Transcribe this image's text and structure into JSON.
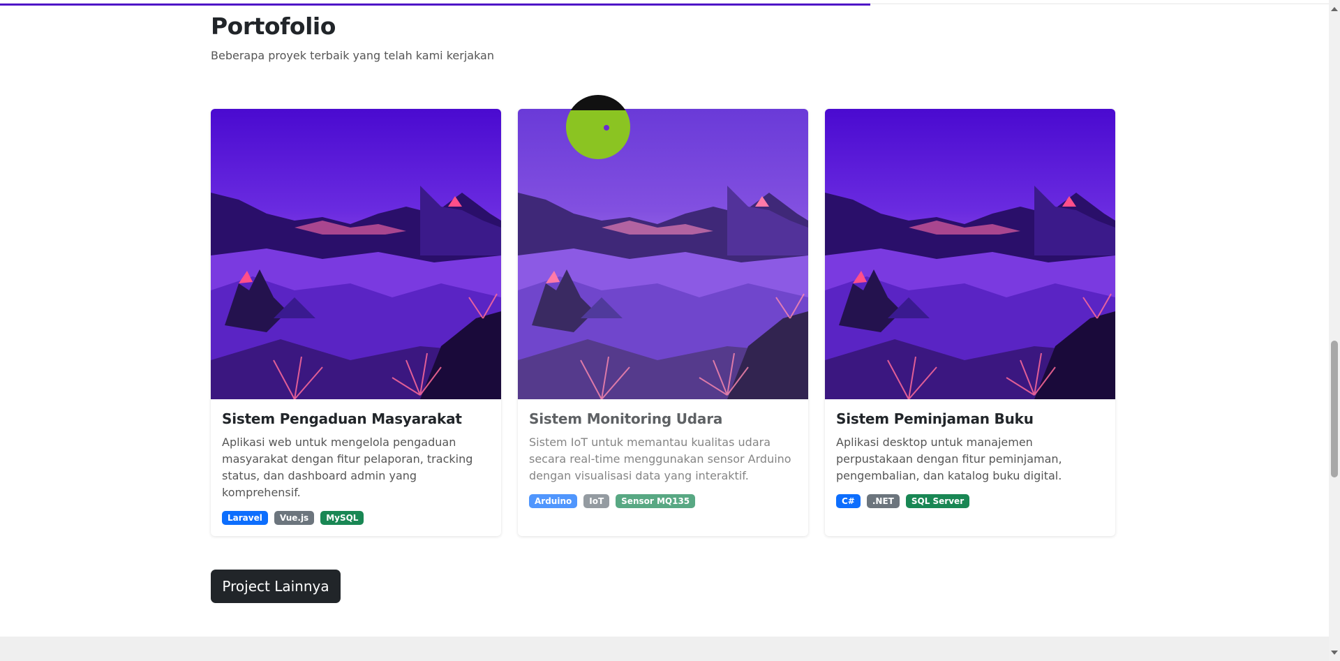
{
  "portfolio": {
    "title": "Portofolio",
    "subtitle": "Beberapa proyek terbaik yang telah kami kerjakan",
    "cards": [
      {
        "title": "Sistem Pengaduan Masyarakat",
        "description": "Aplikasi web untuk mengelola pengaduan masyarakat dengan fitur pelaporan, tracking status, dan dashboard admin yang komprehensif.",
        "tags": [
          {
            "label": "Laravel",
            "color": "#0d6efd"
          },
          {
            "label": "Vue.js",
            "color": "#6c757d"
          },
          {
            "label": "MySQL",
            "color": "#198754"
          }
        ]
      },
      {
        "title": "Sistem Monitoring Udara",
        "description": "Sistem IoT untuk memantau kualitas udara secara real-time menggunakan sensor Arduino dengan visualisasi data yang interaktif.",
        "tags": [
          {
            "label": "Arduino",
            "color": "#0d6efd"
          },
          {
            "label": "IoT",
            "color": "#6c757d"
          },
          {
            "label": "Sensor MQ135",
            "color": "#198754"
          }
        ]
      },
      {
        "title": "Sistem Peminjaman Buku",
        "description": "Aplikasi desktop untuk manajemen perpustakaan dengan fitur peminjaman, pengembalian, dan katalog buku digital.",
        "tags": [
          {
            "label": "C#",
            "color": "#0d6efd"
          },
          {
            "label": ".NET",
            "color": "#6c757d"
          },
          {
            "label": "SQL Server",
            "color": "#198754"
          }
        ]
      }
    ],
    "more_button": "Project Lainnya"
  },
  "colors": {
    "accent": "#4e12c7",
    "dark": "#212529"
  }
}
